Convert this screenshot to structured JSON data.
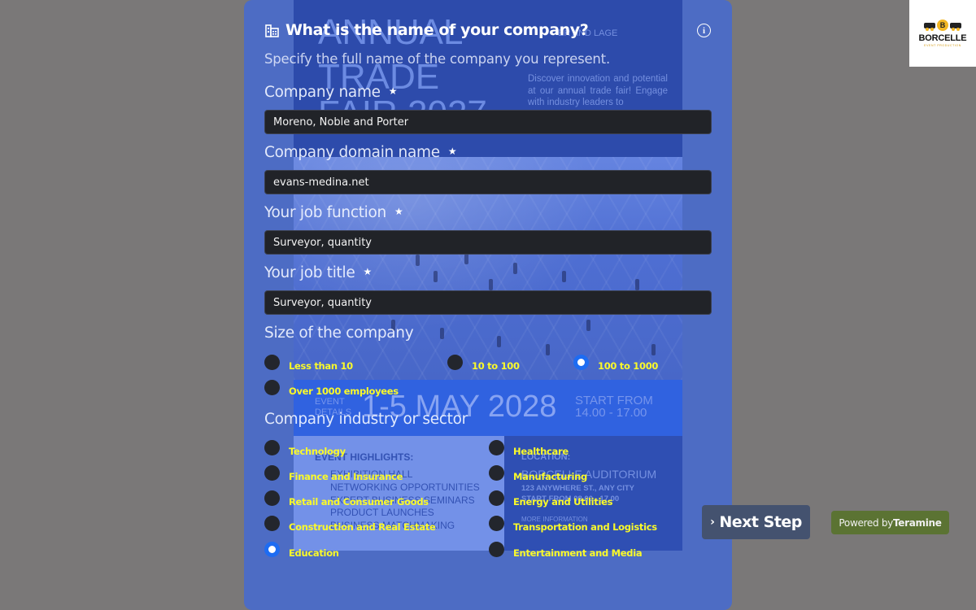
{
  "logo": {
    "badge": "B",
    "brand": "BORCELLE",
    "tagline": "EVENT PRODUCTION"
  },
  "poster": {
    "headline_lines": [
      "ANNUAL",
      "TRADE",
      "FAIR 2027"
    ],
    "byline": "ER AND LAGE",
    "description": "Discover innovation and potential at our annual trade fair! Engage with industry leaders to",
    "event_details_label": [
      "EVENT",
      "DETAILS"
    ],
    "date": "1-5 MAY 2028",
    "start_from": "START FROM",
    "time": "14.00 - 17.00",
    "highlights_title": "EVENT HIGHLIGHTS:",
    "highlights": [
      "EXHIBITION HALL",
      "NETWORKING OPPORTUNITIES",
      "EXPERT BUSINESS SEMINARS",
      "PRODUCT LAUNCHES",
      "BUSINESS MATCHMAKING"
    ],
    "location_title": "LOCATION:",
    "venue": "BORCELLE AUDITORIUM",
    "address": "123 ANYWHERE ST., ANY CITY",
    "venue_time": "START FROM 08.00 - 17.00",
    "more_info": "MORE INFORMATION"
  },
  "form": {
    "title": "What is the name of your company?",
    "subtitle": "Specify the full name of the company you represent.",
    "info_icon": "i",
    "required_mark": "★",
    "fields": [
      {
        "label": "Company name",
        "value": "Moreno, Noble and Porter"
      },
      {
        "label": "Company domain name",
        "value": "evans-medina.net"
      },
      {
        "label": "Your job function",
        "value": "Surveyor, quantity"
      },
      {
        "label": "Your job title",
        "value": "Surveyor, quantity"
      }
    ],
    "size": {
      "label": "Size of the company",
      "options": [
        "Less than 10",
        "10 to 100",
        "100 to 1000",
        "Over 1000 employees"
      ],
      "selected": "100 to 1000"
    },
    "industry": {
      "label": "Company industry or sector",
      "options_left": [
        "Technology",
        "Finance and Insurance",
        "Retail and Consumer Goods",
        "Construction and Real Estate",
        "Education"
      ],
      "options_right": [
        "Healthcare",
        "Manufacturing",
        "Energy and Utilities",
        "Transportation and Logistics",
        "Entertainment and Media"
      ],
      "selected": "Education"
    }
  },
  "footer": {
    "next_icon": "›",
    "next_label": "Next Step",
    "powered_prefix": "Powered by",
    "powered_brand": "Teramine"
  },
  "colors": {
    "panel": "#4d6cc4",
    "accent_radio": "#1d6cf2",
    "option_text": "#fafa2a",
    "next_button": "#44526f",
    "powered_badge": "#5b7333"
  }
}
